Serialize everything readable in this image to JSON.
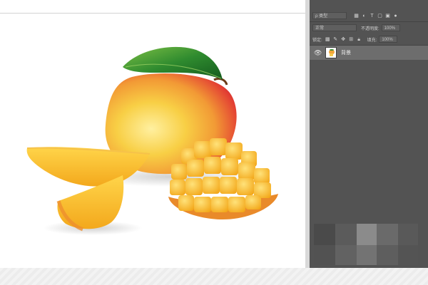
{
  "layers_panel": {
    "filter_label": "ρ 类型",
    "blend_mode": "正常",
    "opacity_label": "不透明度:",
    "opacity_value": "100%",
    "lock_label": "锁定:",
    "fill_label": "填充:",
    "fill_value": "100%",
    "layers": [
      {
        "name": "背景",
        "visible": true
      }
    ]
  },
  "icons": {
    "eye": "eye-icon",
    "layer_thumb": "mango-thumbnail-icon",
    "lock": "lock-icon",
    "link": "chain-icon",
    "move": "move-icon",
    "brush": "brush-icon"
  },
  "colors": {
    "panel_bg": "#535353",
    "layer_selected": "#6d6d6d",
    "canvas_bg": "#ffffff",
    "divider": "#d9d9d9"
  }
}
